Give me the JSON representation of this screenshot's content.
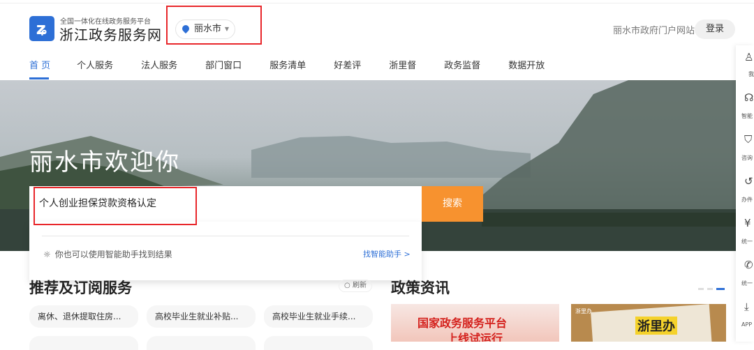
{
  "header": {
    "logo_sub": "全国一体化在线政务服务平台",
    "logo_main": "浙江政务服务网",
    "city": "丽水市",
    "portal_link": "丽水市政府门户网站",
    "login": "登录"
  },
  "nav": [
    "首 页",
    "个人服务",
    "法人服务",
    "部门窗口",
    "服务清单",
    "好差评",
    "浙里督",
    "政务监督",
    "数据开放"
  ],
  "hero": {
    "title": "丽水市欢迎你"
  },
  "search": {
    "value": "个人创业担保贷款资格认定",
    "button": "搜索",
    "tip": "你也可以使用智能助手找到结果",
    "assistant_link": "找智能助手 >"
  },
  "recommend": {
    "title": "推荐及订阅服务",
    "refresh": "刷新",
    "items": [
      "离休、退休提取住房...",
      "高校毕业生就业补贴...",
      "高校毕业生就业手续..."
    ]
  },
  "policy": {
    "title": "政策资讯",
    "news": [
      {
        "headline": "国家政务服务平台",
        "sub": "上线试运行"
      },
      {
        "badge": "浙里办",
        "headline": "浙里办"
      }
    ]
  },
  "sidebar": [
    "我",
    "智能",
    "咨询",
    "办件",
    "统一",
    "统一",
    "APP"
  ],
  "colors": {
    "accent": "#2d6fd6",
    "search_button": "#f7922f",
    "highlight": "#e8262a"
  }
}
